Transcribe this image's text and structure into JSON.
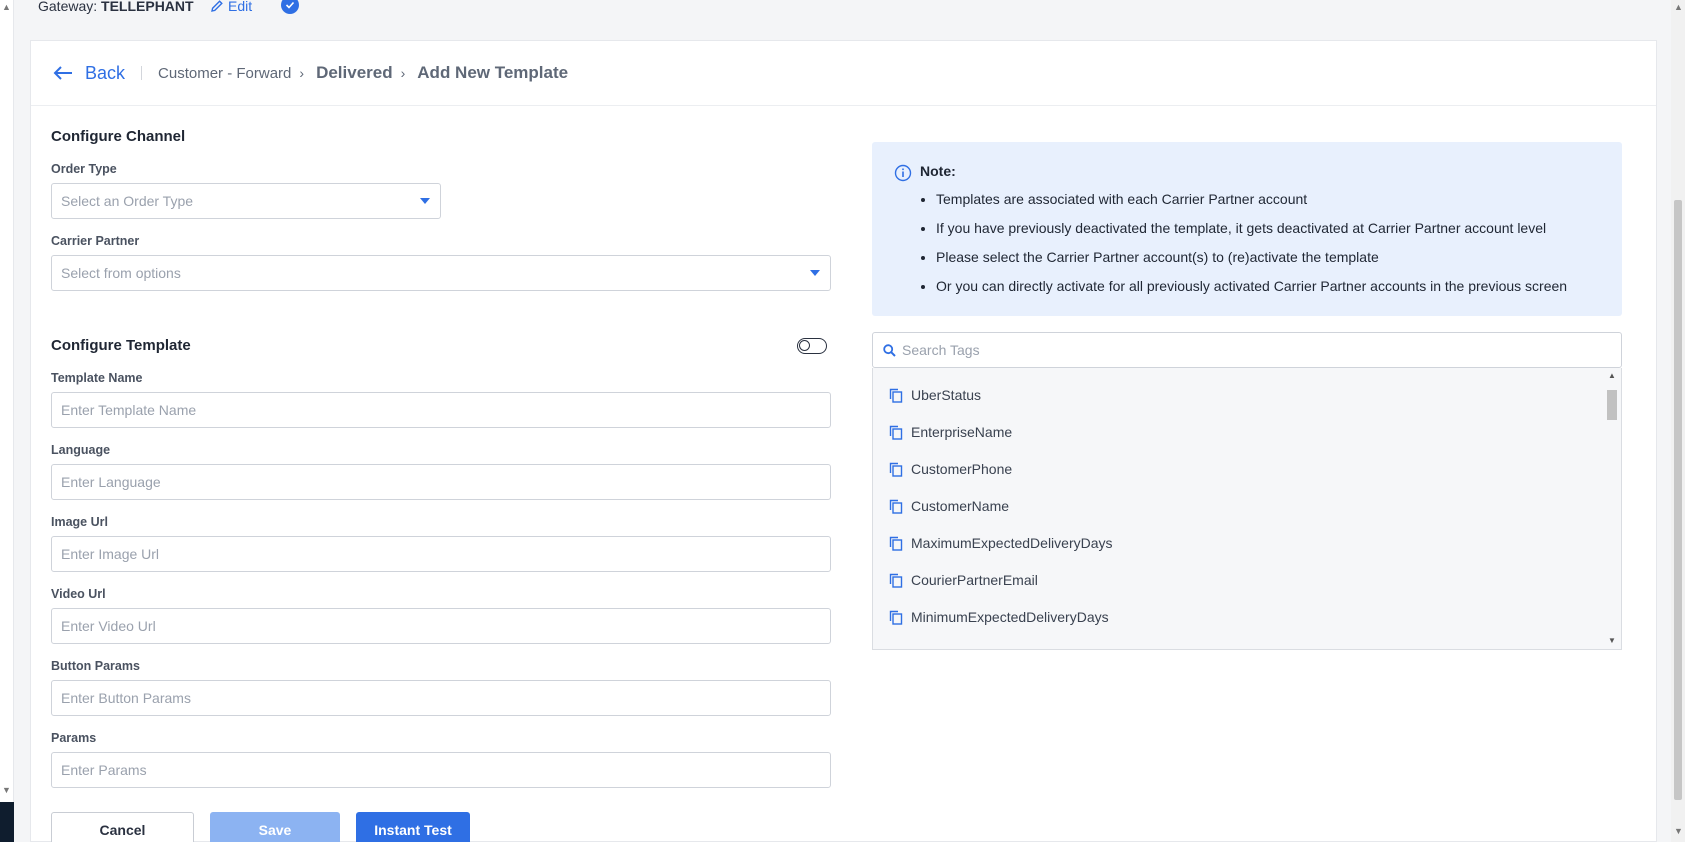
{
  "gateway": {
    "label": "Gateway:",
    "name": "TELLEPHANT",
    "edit_label": "Edit"
  },
  "header": {
    "back_label": "Back",
    "breadcrumb": [
      "Customer - Forward",
      "Delivered",
      "Add New Template"
    ]
  },
  "configure_channel": {
    "title": "Configure Channel",
    "order_type": {
      "label": "Order Type",
      "placeholder": "Select an Order Type"
    },
    "carrier_partner": {
      "label": "Carrier Partner",
      "placeholder": "Select from options"
    }
  },
  "configure_template": {
    "title": "Configure Template",
    "toggle_on": false,
    "fields": [
      {
        "label": "Template Name",
        "placeholder": "Enter Template Name"
      },
      {
        "label": "Language",
        "placeholder": "Enter Language"
      },
      {
        "label": "Image Url",
        "placeholder": "Enter Image Url"
      },
      {
        "label": "Video Url",
        "placeholder": "Enter Video Url"
      },
      {
        "label": "Button Params",
        "placeholder": "Enter Button Params"
      },
      {
        "label": "Params",
        "placeholder": "Enter Params"
      }
    ]
  },
  "actions": {
    "cancel": "Cancel",
    "save": "Save",
    "instant_test": "Instant Test"
  },
  "note": {
    "title": "Note:",
    "items": [
      "Templates are associated with each Carrier Partner account",
      "If you have previously deactivated the template, it gets deactivated at Carrier Partner account level",
      "Please select the Carrier Partner account(s) to (re)activate the template",
      "Or you can directly activate for all previously activated Carrier Partner accounts in the previous screen"
    ]
  },
  "tags": {
    "search_placeholder": "Search Tags",
    "items": [
      "UberStatus",
      "EnterpriseName",
      "CustomerPhone",
      "CustomerName",
      "MaximumExpectedDeliveryDays",
      "CourierPartnerEmail",
      "MinimumExpectedDeliveryDays"
    ]
  },
  "colors": {
    "accent": "#2f6fe4",
    "note_bg": "#e8f0fd",
    "save_disabled": "#8cb3f2"
  }
}
